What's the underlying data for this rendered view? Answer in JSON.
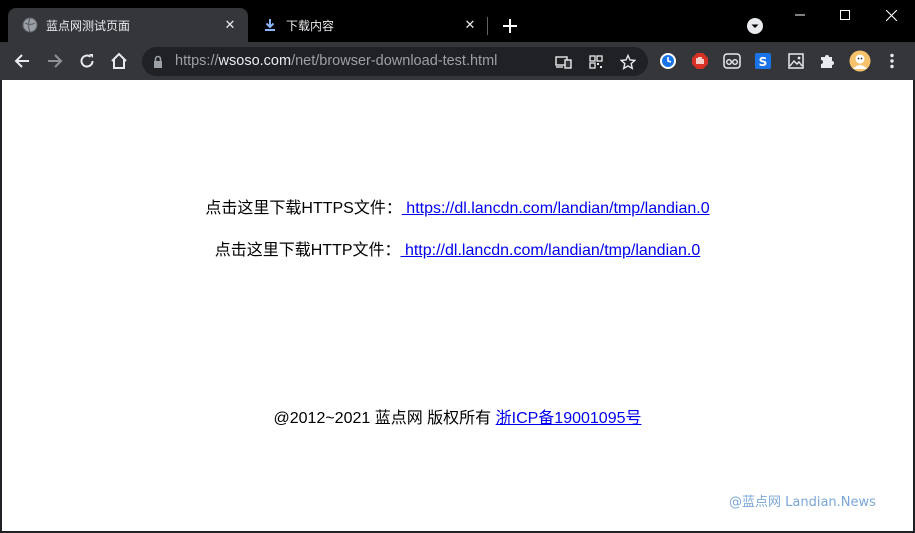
{
  "tabs": [
    {
      "title": "蓝点网测试页面",
      "active": true
    },
    {
      "title": "下载内容",
      "active": false
    }
  ],
  "toolbar": {
    "url_scheme": "https://",
    "url_host": "wsoso.com",
    "url_path": "/net/browser-download-test.html"
  },
  "page": {
    "https_label": "点击这里下载HTTPS文件：",
    "https_link": " https://dl.lancdn.com/landian/tmp/landian.0",
    "http_label": "点击这里下载HTTP文件：",
    "http_link": " http://dl.lancdn.com/landian/tmp/landian.0",
    "footer_text": "@2012~2021 蓝点网 版权所有 ",
    "footer_link": "浙ICP备19001095号"
  },
  "watermark": "@蓝点网 Landian.News",
  "colors": {
    "tabstrip_bg": "#000000",
    "toolbar_bg": "#35363a",
    "omnibox_bg": "#202124",
    "link": "#0000ee"
  }
}
